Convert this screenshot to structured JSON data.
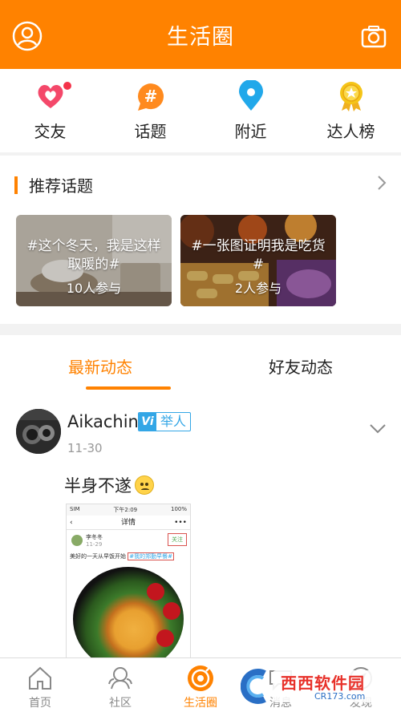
{
  "header": {
    "title": "生活圈",
    "left_icon": "profile-icon",
    "right_icon": "camera-icon",
    "accent": "#ff8200"
  },
  "quicknav": [
    {
      "label": "交友",
      "icon": "heart-icon",
      "has_dot": true
    },
    {
      "label": "话题",
      "icon": "topic-hash-icon",
      "has_dot": false
    },
    {
      "label": "附近",
      "icon": "location-pin-icon",
      "has_dot": false
    },
    {
      "label": "达人榜",
      "icon": "medal-icon",
      "has_dot": false
    }
  ],
  "recommend": {
    "title": "推荐话题",
    "cards": [
      {
        "topic": "#这个冬天，我是这样取暖的#",
        "count": "10人参与"
      },
      {
        "topic": "#一张图证明我是吃货#",
        "count": "2人参与"
      }
    ]
  },
  "feed": {
    "tabs": [
      "最新动态",
      "好友动态"
    ],
    "active_tab": 0,
    "post": {
      "username": "Aikachin",
      "badge_v": "Vi",
      "badge_text": "举人",
      "time": "11-30",
      "content": "半身不遂",
      "image": {
        "status_left": "SIM",
        "status_time": "下午2:09",
        "status_right": "100%",
        "title": "详情",
        "nav_more": "•••",
        "user": "李冬冬",
        "user_sub": "11-29",
        "follow": "关注",
        "text_prefix": "美好的一天从早饭开始",
        "tag": "#我的郑勤早餐#"
      }
    }
  },
  "tabbar": [
    {
      "label": "首页",
      "icon": "home-icon",
      "active": false
    },
    {
      "label": "社区",
      "icon": "community-icon",
      "active": false
    },
    {
      "label": "生活圈",
      "icon": "life-circle-icon",
      "active": true
    },
    {
      "label": "消息",
      "icon": "message-icon",
      "active": false
    },
    {
      "label": "发现",
      "icon": "discover-icon",
      "active": false
    }
  ],
  "watermark": {
    "text": "西西软件园",
    "sub": "CR173.com"
  }
}
